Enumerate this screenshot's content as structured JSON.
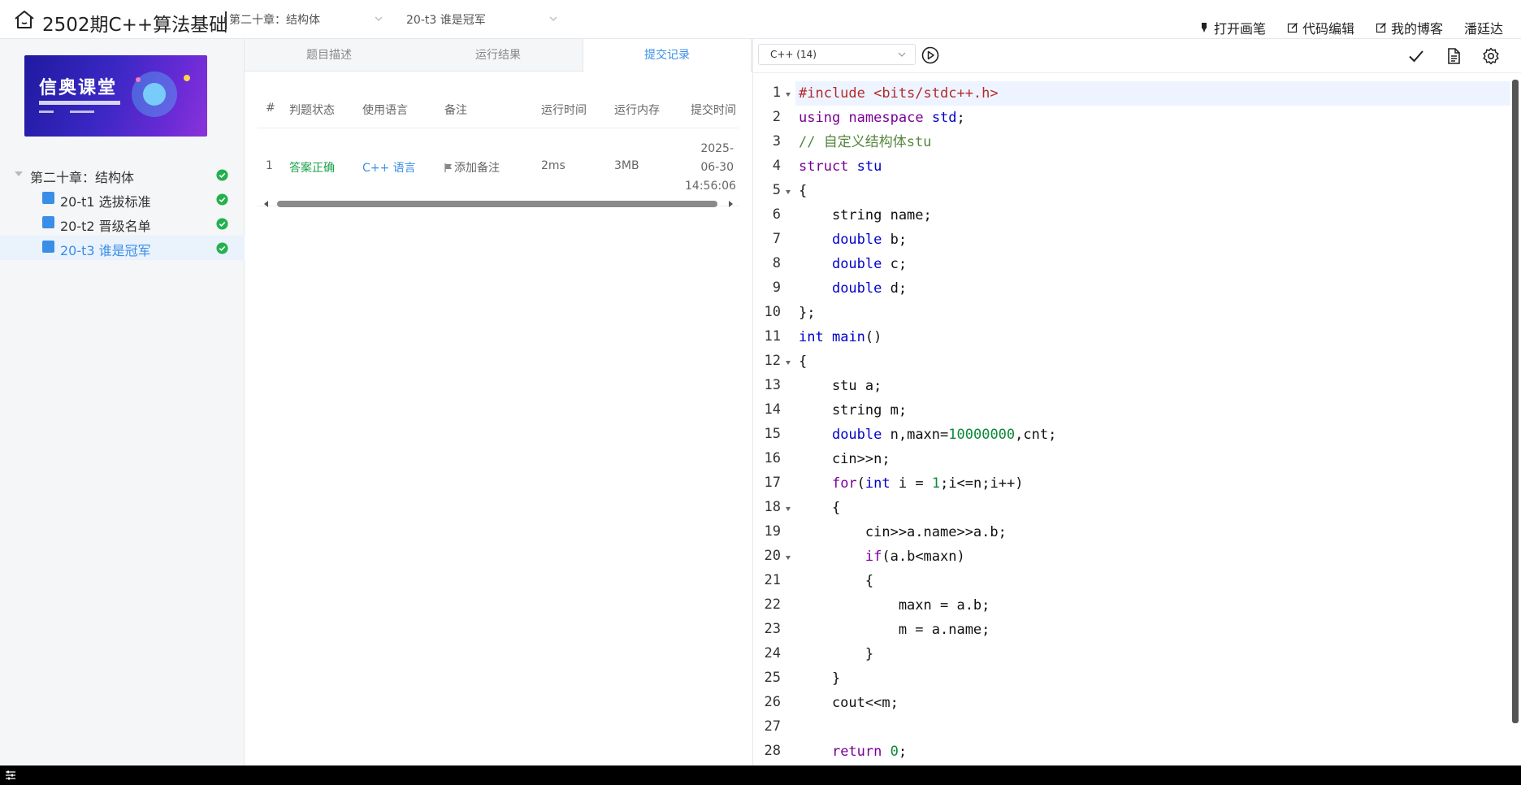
{
  "header": {
    "course_title": "2502期C++算法基础",
    "chapter_select": "第二十章：结构体",
    "problem_select": "20-t3 谁是冠军",
    "actions": {
      "open_pen": "打开画笔",
      "code_edit": "代码编辑",
      "my_blog": "我的博客",
      "username": "潘廷达"
    }
  },
  "sidebar": {
    "banner_title": "信奥课堂",
    "chapter": "第二十章：结构体",
    "problems": [
      {
        "label": "20-t1 选拔标准"
      },
      {
        "label": "20-t2 晋级名单"
      },
      {
        "label": "20-t3 谁是冠军"
      }
    ]
  },
  "tabs": [
    "题目描述",
    "运行结果",
    "提交记录"
  ],
  "submissions": {
    "headers": [
      "#",
      "判题状态",
      "使用语言",
      "备注",
      "运行时间",
      "运行内存",
      "提交时间"
    ],
    "rows": [
      {
        "index": "1",
        "status": "答案正确",
        "language": "C++ 语言",
        "note": "添加备注",
        "run_time": "2ms",
        "memory": "3MB",
        "submit_time": "2025-06-30 14:56:06"
      }
    ]
  },
  "editor": {
    "language": "C++ (14)",
    "line_numbers": [
      "1",
      "2",
      "3",
      "4",
      "5",
      "6",
      "7",
      "8",
      "9",
      "10",
      "11",
      "12",
      "13",
      "14",
      "15",
      "16",
      "17",
      "18",
      "19",
      "20",
      "21",
      "22",
      "23",
      "24",
      "25",
      "26",
      "27",
      "28"
    ]
  },
  "colors": {
    "accent": "#3a8ee6",
    "success": "#19a34a",
    "keyword": "#0000cc",
    "preprocessor": "#b5292b",
    "comment": "#55863d",
    "number": "#0b8a3b"
  },
  "icons": {
    "home": "home-icon",
    "pen": "pen-icon",
    "edit": "edit-icon",
    "blog": "blog-edit-icon",
    "run": "play-circle-icon",
    "check": "check-icon",
    "doc": "document-icon",
    "settings": "gear-icon"
  }
}
